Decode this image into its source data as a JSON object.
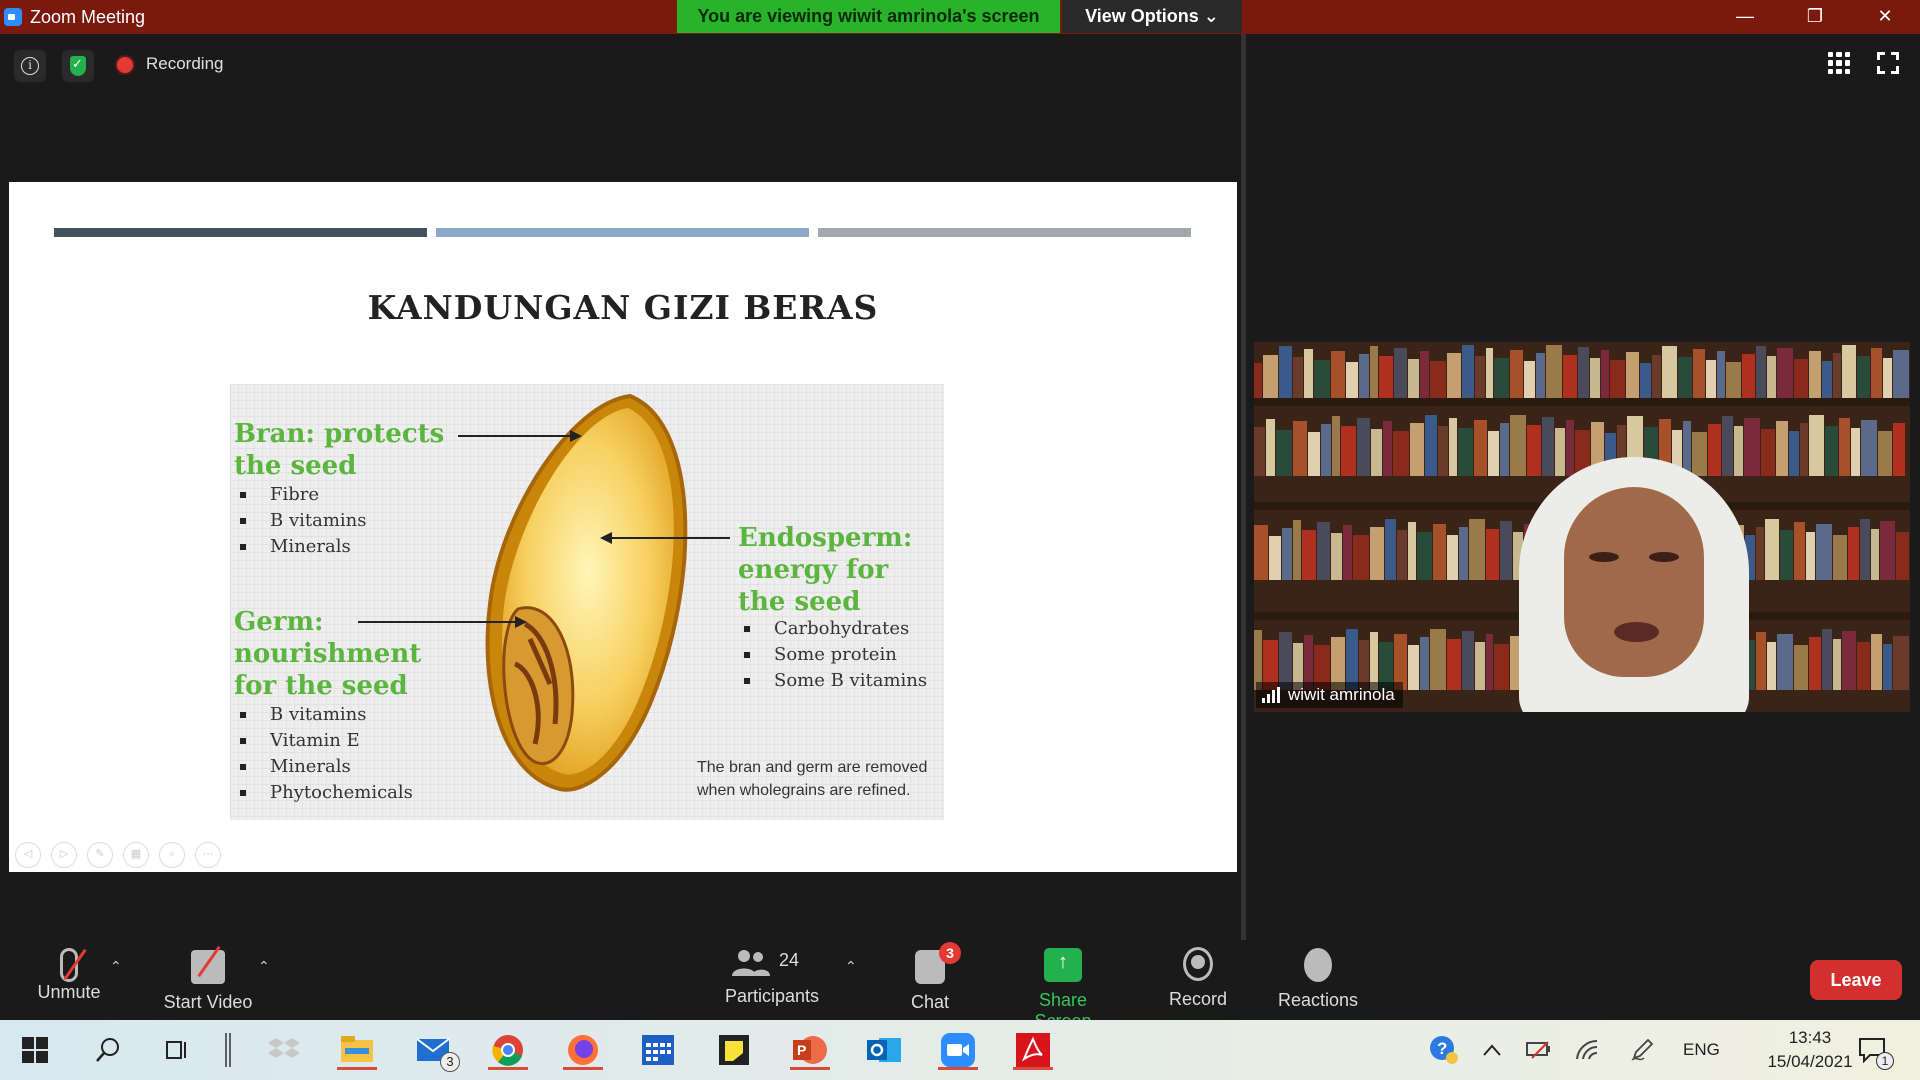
{
  "window": {
    "title": "Zoom Meeting",
    "minimize": "—",
    "restore": "❐",
    "close": "✕"
  },
  "banner": {
    "viewing": "You are viewing wiwit amrinola's screen",
    "view_options": "View Options ⌄"
  },
  "status": {
    "recording_label": "Recording"
  },
  "slide": {
    "title": "KANDUNGAN GIZI BERAS",
    "bran": {
      "heading": [
        "Bran: protects",
        "the seed"
      ],
      "items": [
        "Fibre",
        "B vitamins",
        "Minerals"
      ]
    },
    "germ": {
      "heading": [
        "Germ:",
        "nourishment",
        "for the seed"
      ],
      "items": [
        "B vitamins",
        "Vitamin E",
        "Minerals",
        "Phytochemicals"
      ]
    },
    "endosperm": {
      "heading": [
        "Endosperm:",
        "energy for",
        "the seed"
      ],
      "items": [
        "Carbohydrates",
        "Some protein",
        "Some B vitamins"
      ]
    },
    "note": [
      "The bran and germ are removed",
      "when wholegrains are refined."
    ]
  },
  "participant": {
    "name": "wiwit amrinola"
  },
  "toolbar": {
    "unmute": "Unmute",
    "start_video": "Start Video",
    "participants": "Participants",
    "participants_count": "24",
    "chat": "Chat",
    "chat_badge": "3",
    "share_screen": "Share Screen",
    "share_arrow": "↑",
    "record": "Record",
    "reactions": "Reactions",
    "leave": "Leave",
    "caret": "⌃"
  },
  "taskbar": {
    "mail_badge": "3",
    "language": "ENG",
    "time": "13:43",
    "date": "15/04/2021",
    "notification_badge": "1"
  },
  "colors": {
    "titlebar": "#7a1a0e",
    "banner_green": "#29b32a",
    "leave_red": "#d32f2f",
    "diagram_green": "#5bb53f"
  }
}
